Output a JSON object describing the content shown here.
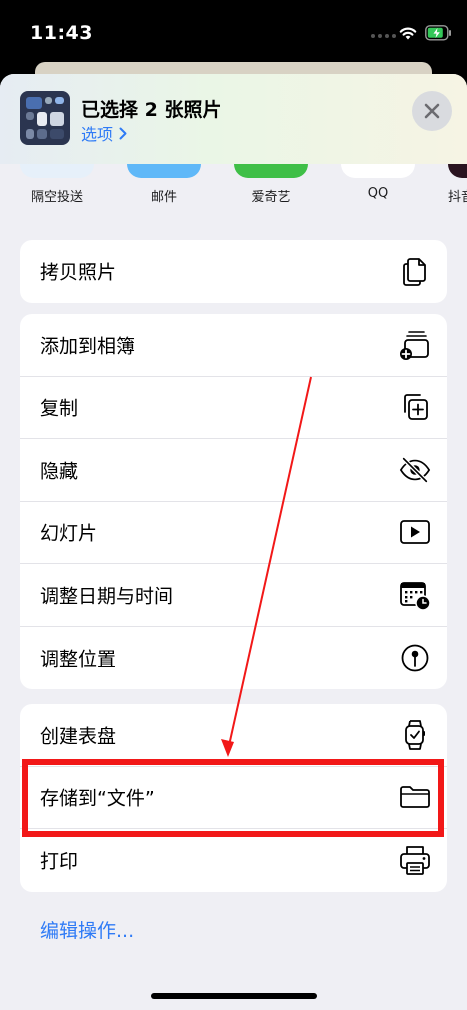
{
  "status_bar": {
    "time": "11:43"
  },
  "header": {
    "title": "已选择 2 张照片",
    "options_label": "选项"
  },
  "share_apps": [
    {
      "label": "隔空投送",
      "color": "#d8eaf8"
    },
    {
      "label": "邮件",
      "color": "#5fb8f8"
    },
    {
      "label": "爱奇艺",
      "color": "#3fbf47"
    },
    {
      "label": "QQ",
      "color": "#ffffff"
    },
    {
      "label": "抖音",
      "color": "#2a1420"
    }
  ],
  "groups": [
    {
      "items": [
        {
          "label": "拷贝照片",
          "icon": "copy-photos-icon"
        }
      ]
    },
    {
      "items": [
        {
          "label": "添加到相簿",
          "icon": "add-to-album-icon"
        },
        {
          "label": "复制",
          "icon": "duplicate-icon"
        },
        {
          "label": "隐藏",
          "icon": "hide-eye-slash-icon"
        },
        {
          "label": "幻灯片",
          "icon": "slideshow-play-icon"
        },
        {
          "label": "调整日期与时间",
          "icon": "calendar-clock-icon"
        },
        {
          "label": "调整位置",
          "icon": "location-pin-icon"
        }
      ]
    },
    {
      "items": [
        {
          "label": "创建表盘",
          "icon": "watch-icon"
        },
        {
          "label": "存储到“文件”",
          "icon": "folder-icon"
        },
        {
          "label": "打印",
          "icon": "printer-icon"
        }
      ]
    }
  ],
  "edit_actions_label": "编辑操作...",
  "colors": {
    "accent": "#2f7bf6",
    "annotation": "#f21818"
  }
}
